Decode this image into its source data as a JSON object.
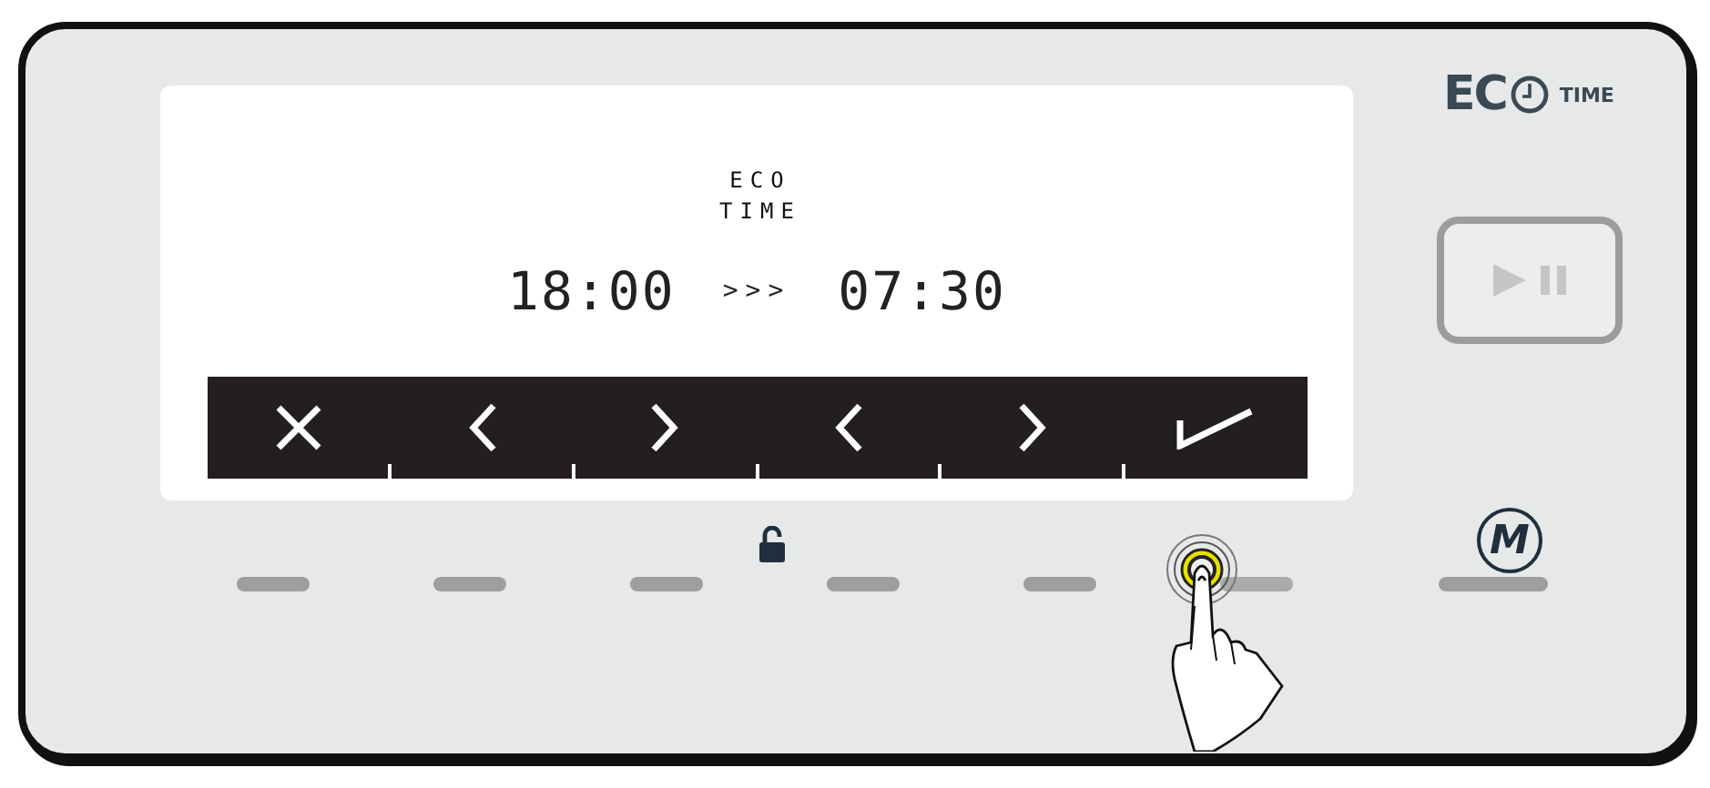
{
  "logo": {
    "brand": "EC",
    "suffix": "TIME"
  },
  "display": {
    "mode_line_1": "ECO",
    "mode_line_2": "TIME",
    "start_time": "18:00",
    "arrows": ">>>",
    "end_time": "07:30",
    "softkeys": [
      {
        "kind": "cancel"
      },
      {
        "kind": "left"
      },
      {
        "kind": "right"
      },
      {
        "kind": "left"
      },
      {
        "kind": "right"
      },
      {
        "kind": "confirm"
      }
    ]
  },
  "lock": {
    "locked": false
  },
  "menu_button": {
    "label": "M"
  },
  "touch_pads": [
    {
      "selected": false
    },
    {
      "selected": false
    },
    {
      "selected": false
    },
    {
      "selected": false
    },
    {
      "selected": false
    },
    {
      "selected": true
    }
  ]
}
